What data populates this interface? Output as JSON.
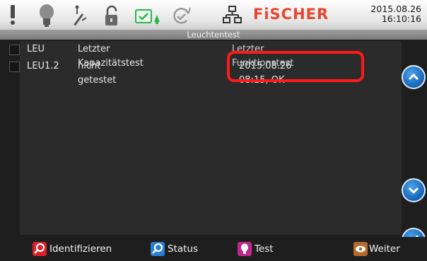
{
  "header": {
    "logo": "FiSCHER",
    "date": "2015.08.26",
    "time": "16:10:16",
    "icons": [
      "exclamation-icon",
      "lightbulb-icon",
      "plug-icon",
      "padlock-icon",
      "battery-check-icon",
      "refresh-check-icon",
      "network-icon"
    ]
  },
  "title": "Leuchtentest",
  "table": {
    "columns": [
      "LEU",
      "Letzter Kapazitätstest",
      "Letzter Funktionstest"
    ],
    "rows": [
      {
        "name": "LEU1.2",
        "capacity_test": "nicht getestet",
        "function_test": "2015.08.26 08:15, OK"
      }
    ]
  },
  "buttons": {
    "identify": "Identifizieren",
    "status": "Status",
    "test": "Test",
    "next": "Weiter"
  },
  "colors": {
    "logo": "#e8452c",
    "highlight": "#ff1a1a",
    "accent_blue": "#1e78c8"
  }
}
